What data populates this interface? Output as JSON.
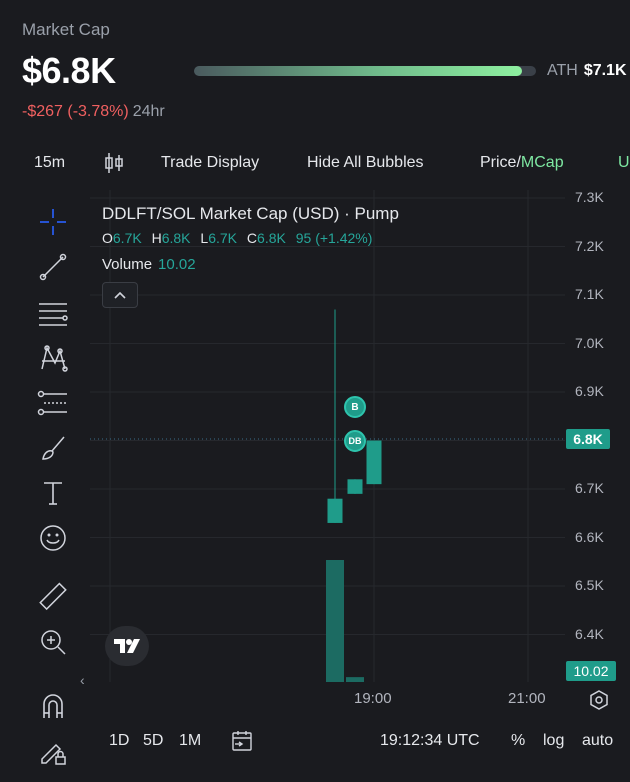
{
  "header": {
    "label": "Market Cap",
    "value": "$6.8K",
    "change": "-$267 (-3.78%)",
    "period": "24hr",
    "ath_label": "ATH",
    "ath_value": "$7.1K",
    "ath_progress": 0.96
  },
  "toolbar": {
    "interval": "15m",
    "trade_display": "Trade Display",
    "hide_bubbles": "Hide All Bubbles",
    "price": "Price",
    "slash": "/",
    "mcap": "MCap",
    "cut": "U"
  },
  "legend": {
    "title": "DDLFT/SOL Market Cap (USD) · Pump",
    "o_label": "O",
    "o": "6.7K",
    "h_label": "H",
    "h": "6.8K",
    "l_label": "L",
    "l": "6.7K",
    "c_label": "C",
    "c": "6.8K",
    "change": "95 (+1.42%)",
    "volume_label": "Volume",
    "volume": "10.02",
    "collapse": "^"
  },
  "chart_data": {
    "type": "candlestick",
    "y_ticks": [
      "7.3K",
      "7.2K",
      "7.1K",
      "7.0K",
      "6.9K",
      "6.8K",
      "6.7K",
      "6.6K",
      "6.5K",
      "6.4K"
    ],
    "ylim": [
      6.3,
      7.3
    ],
    "x_ticks": [
      "19:00",
      "21:00"
    ],
    "candles": [
      {
        "open": 6.63,
        "close": 6.68,
        "high": 7.07,
        "low": 6.63
      },
      {
        "open": 6.69,
        "close": 6.72,
        "high": 6.72,
        "low": 6.69
      },
      {
        "open": 6.71,
        "close": 6.8,
        "high": 6.8,
        "low": 6.71
      }
    ],
    "volume": [
      10.02,
      0.4,
      0
    ],
    "current_price": "6.8K",
    "current_volume": "10.02",
    "bubbles": [
      "B",
      "DB"
    ]
  },
  "bottom": {
    "ranges": [
      "1D",
      "5D",
      "1M"
    ],
    "time": "19:12:34 UTC",
    "percent": "%",
    "log": "log",
    "auto": "auto"
  },
  "colors": {
    "up": "#1f9c8a",
    "down": "#f06060",
    "accent": "#7ee8a2"
  }
}
